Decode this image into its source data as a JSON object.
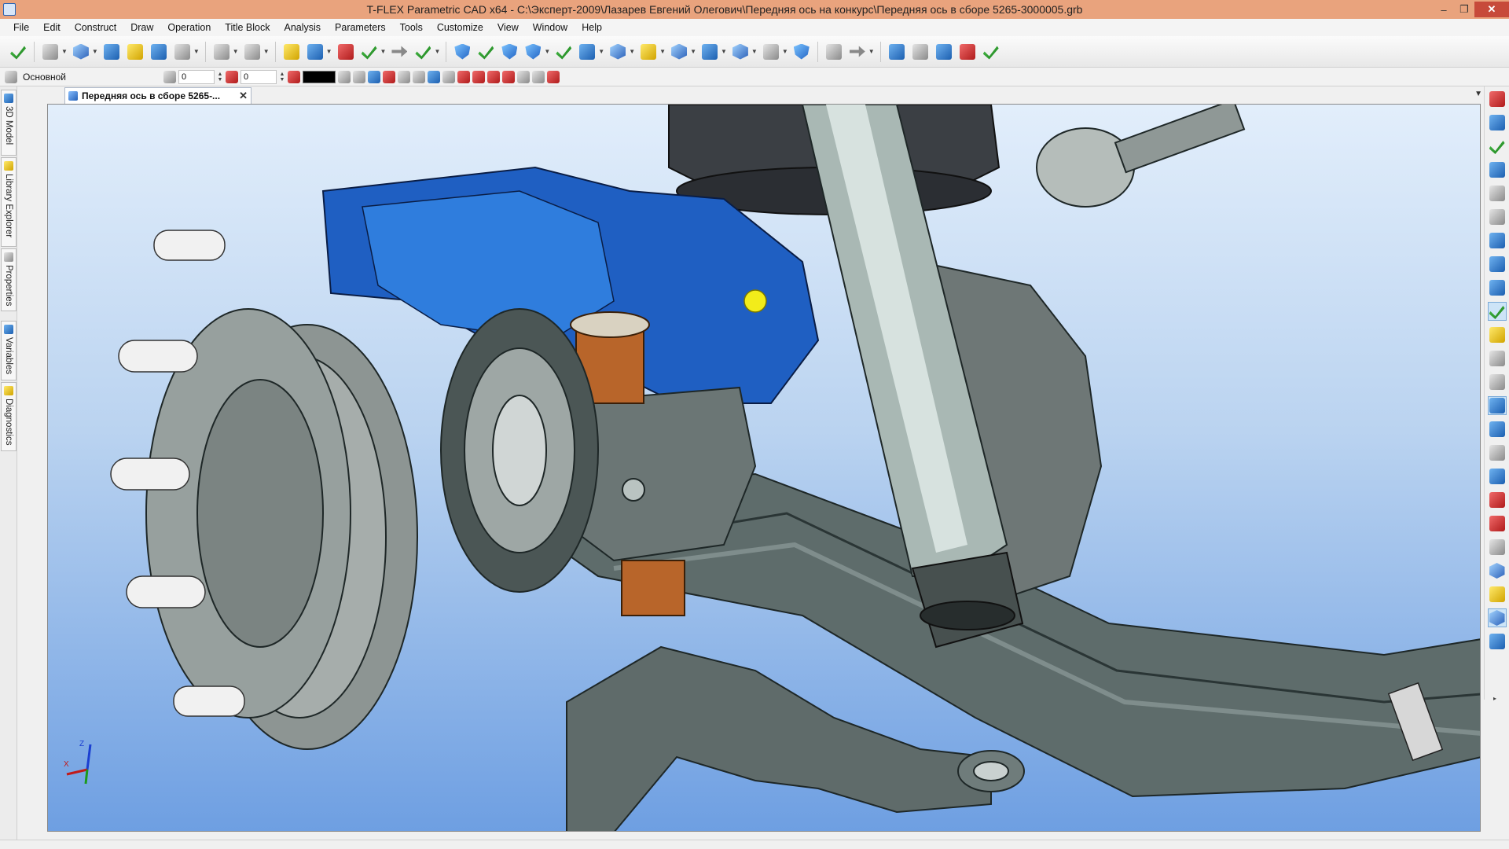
{
  "window": {
    "title": "T-FLEX Parametric CAD x64 - C:\\Эксперт-2009\\Лазарев Евгений Олегович\\Передняя ось на конкурс\\Передняя ось в сборе 5265-3000005.grb",
    "minimize": "–",
    "restore": "❐",
    "close": "✕"
  },
  "menu": [
    "File",
    "Edit",
    "Construct",
    "Draw",
    "Operation",
    "Title Block",
    "Analysis",
    "Parameters",
    "Tools",
    "Customize",
    "View",
    "Window",
    "Help"
  ],
  "toolbar2": {
    "layer": "Основной",
    "level_value": "0",
    "priority_value": "0",
    "color": "#000000"
  },
  "left_tabs": [
    "3D Model",
    "Library Explorer",
    "Properties",
    "Variables",
    "Diagnostics"
  ],
  "document_tab": {
    "label": "Передняя ось в сборе 5265-...",
    "close": "✕"
  },
  "triad": {
    "z": "Z",
    "x": "X"
  },
  "colors": {
    "titlebar": "#e9a37d",
    "viewport_top": "#e2eefb",
    "viewport_bottom": "#6e9fe2",
    "part_blue": "#1f5fc2",
    "part_gray": "#5d6a6a",
    "part_dark": "#3e4b4c",
    "bronze": "#b8652a"
  }
}
